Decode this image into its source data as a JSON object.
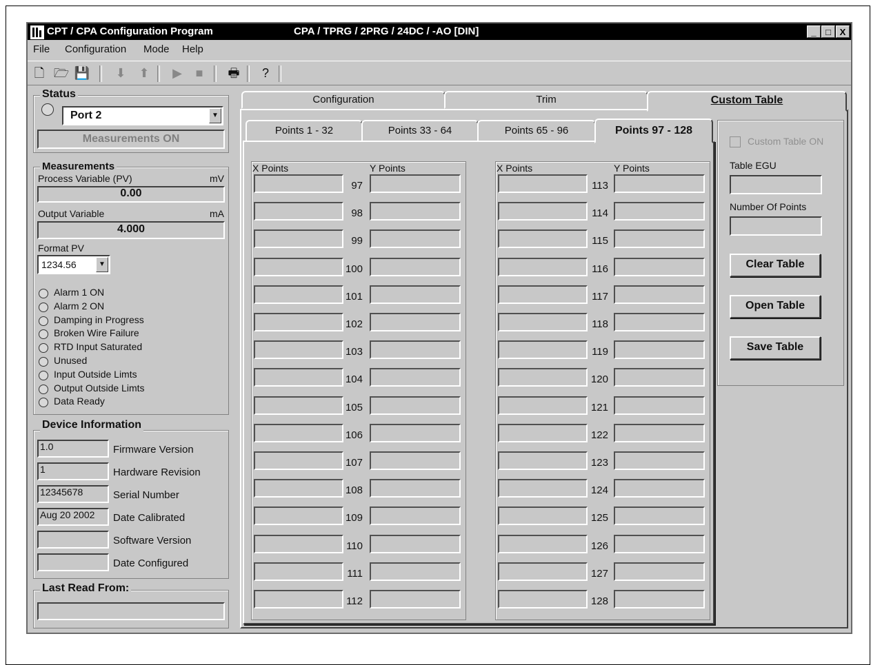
{
  "window": {
    "app_title": "CPT / CPA Configuration Program",
    "device_title": "CPA / TPRG / 2PRG / 24DC / -AO [DIN]",
    "min_label": "_",
    "max_label": "□",
    "close_label": "X"
  },
  "menu": {
    "file": "File",
    "configuration": "Configuration",
    "mode": "Mode",
    "help": "Help"
  },
  "toolbar": {
    "icons": [
      "new-icon",
      "open-icon",
      "save-icon",
      "download-icon",
      "upload-icon",
      "play-icon",
      "stop-icon",
      "print-icon",
      "help-icon"
    ],
    "glyphs": {
      "new": "🗋",
      "open": "🗁",
      "save": "💾",
      "down": "⬇",
      "up": "⬆",
      "play": "▶",
      "stop": "■",
      "print": "🖶",
      "help": "?"
    }
  },
  "status": {
    "label": "Status",
    "port": "Port 2",
    "measurements": "Measurements ON"
  },
  "measurements": {
    "label": "Measurements",
    "pv_label": "Process Variable (PV)",
    "pv_unit": "mV",
    "pv_value": "0.00",
    "ov_label": "Output Variable",
    "ov_unit": "mA",
    "ov_value": "4.000",
    "format_label": "Format PV",
    "format_value": "1234.56",
    "flags": [
      "Alarm 1 ON",
      "Alarm 2 ON",
      "Damping in Progress",
      "Broken Wire Failure",
      "RTD Input Saturated",
      "Unused",
      "Input Outside Limts",
      "Output Outside Limts",
      "Data Ready"
    ]
  },
  "device": {
    "label": "Device Information",
    "rows": [
      {
        "value": "1.0",
        "label": "Firmware Version"
      },
      {
        "value": "1",
        "label": "Hardware Revision"
      },
      {
        "value": "12345678",
        "label": "Serial Number"
      },
      {
        "value": "Aug 20 2002",
        "label": "Date Calibrated"
      },
      {
        "value": "",
        "label": "Software Version"
      },
      {
        "value": "",
        "label": "Date Configured"
      }
    ]
  },
  "last_read": {
    "label": "Last Read From:",
    "value": ""
  },
  "main_tabs": [
    "Configuration",
    "Trim",
    "Custom Table"
  ],
  "sub_tabs": [
    "Points 1 - 32",
    "Points 33 - 64",
    "Points 65 - 96",
    "Points 97 - 128"
  ],
  "table": {
    "x_header": "X Points",
    "y_header": "Y Points",
    "left_numbers": [
      "97",
      "98",
      "99",
      "100",
      "101",
      "102",
      "103",
      "104",
      "105",
      "106",
      "107",
      "108",
      "109",
      "110",
      "111",
      "112"
    ],
    "right_numbers": [
      "113",
      "114",
      "115",
      "116",
      "117",
      "118",
      "119",
      "120",
      "121",
      "122",
      "123",
      "124",
      "125",
      "126",
      "127",
      "128"
    ]
  },
  "custom_panel": {
    "enable_label": "Custom Table ON",
    "egu_label": "Table EGU",
    "egu_value": "",
    "points_label": "Number Of Points",
    "points_value": "",
    "clear": "Clear Table",
    "open": "Open Table",
    "save": "Save Table"
  }
}
